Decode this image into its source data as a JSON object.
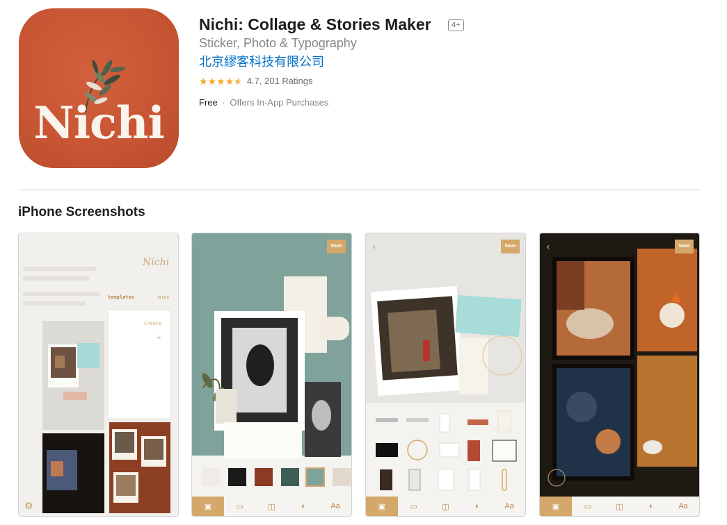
{
  "app": {
    "title": "Nichi: Collage & Stories Maker",
    "age_rating": "4+",
    "subtitle": "Sticker, Photo & Typography",
    "developer": "北京繆客科技有限公司",
    "rating_value": 4.7,
    "rating_text": "4.7, 201 Ratings",
    "price": "Free",
    "separator": "·",
    "in_app": "Offers In-App Purchases",
    "icon_word": "Nichi",
    "icon_color": "#c75533"
  },
  "screenshots": {
    "section_title": "iPhone Screenshots",
    "save_label": "Save",
    "templates_label": "templates",
    "mine_label": "mine",
    "create_label": "Create",
    "logo_word": "Nichi",
    "toolbar_icons": [
      "image-icon",
      "layout-icon",
      "sticker-icon",
      "brush-icon",
      "text-icon"
    ],
    "accent_color": "#d4a86a"
  }
}
